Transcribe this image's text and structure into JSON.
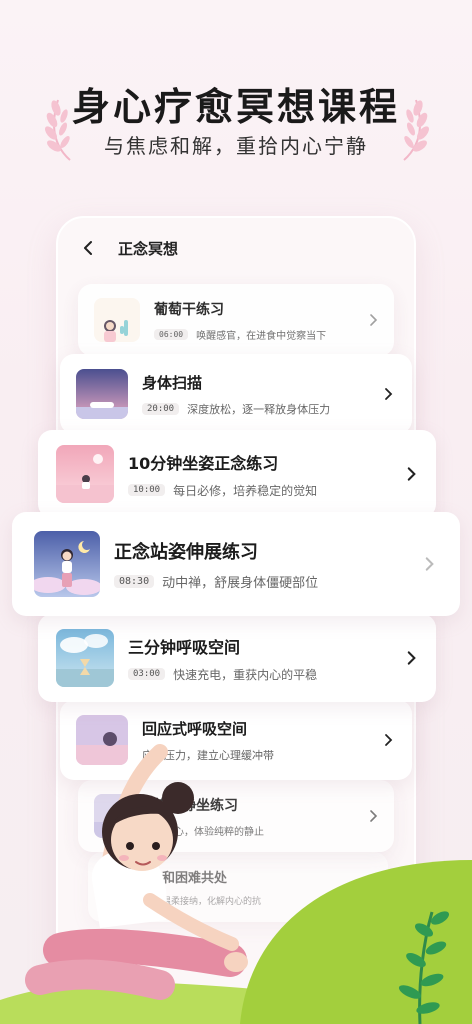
{
  "hero": {
    "title": "身心疗愈冥想课程",
    "subtitle": "与焦虑和解，重拾内心宁静"
  },
  "nav": {
    "back_icon": "chevron-left-icon",
    "title": "正念冥想"
  },
  "courses": [
    {
      "name": "葡萄干练习",
      "duration": "06:00",
      "desc": "唤醒感官，在进食中觉察当下"
    },
    {
      "name": "身体扫描",
      "duration": "20:00",
      "desc": "深度放松，逐一释放身体压力"
    },
    {
      "name": "10分钟坐姿正念练习",
      "duration": "10:00",
      "desc": "每日必修，培养稳定的觉知"
    },
    {
      "name": "正念站姿伸展练习",
      "duration": "08:30",
      "desc": "动中禅，舒展身体僵硬部位"
    },
    {
      "name": "三分钟呼吸空间",
      "duration": "03:00",
      "desc": "快速充电，重获内心的平稳"
    },
    {
      "name": "回应式呼吸空间",
      "duration": "",
      "desc": "应对压力，建立心理缓冲带"
    },
    {
      "name": "练习静坐练习",
      "duration": "",
      "desc": "大内心，体验纯粹的静止"
    },
    {
      "name": "和困难共处",
      "duration": "",
      "desc": "温柔接纳，化解内心的抗"
    }
  ],
  "colors": {
    "background": "#f9eef2",
    "laurel": "#f2b7c8",
    "hill": "#9fcf3c",
    "chevron": "#333333"
  }
}
